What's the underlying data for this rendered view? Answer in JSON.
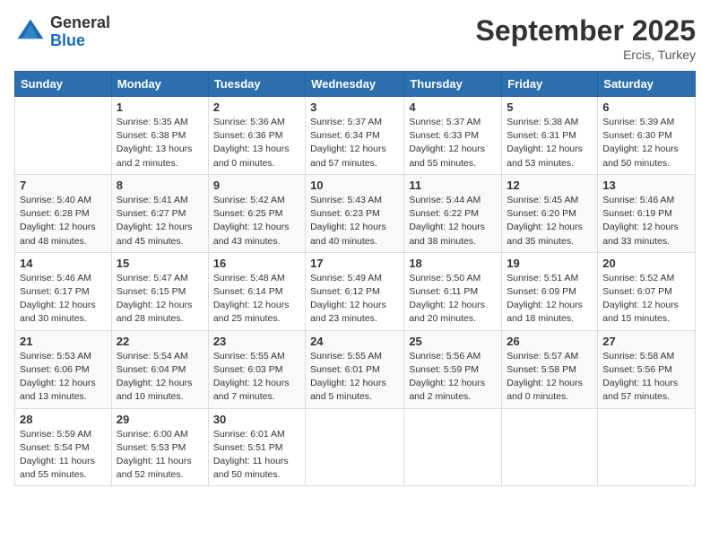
{
  "header": {
    "logo_general": "General",
    "logo_blue": "Blue",
    "month_title": "September 2025",
    "location": "Ercis, Turkey"
  },
  "days_of_week": [
    "Sunday",
    "Monday",
    "Tuesday",
    "Wednesday",
    "Thursday",
    "Friday",
    "Saturday"
  ],
  "weeks": [
    [
      {
        "day": null
      },
      {
        "day": 1,
        "sunrise": "Sunrise: 5:35 AM",
        "sunset": "Sunset: 6:38 PM",
        "daylight": "Daylight: 13 hours and 2 minutes."
      },
      {
        "day": 2,
        "sunrise": "Sunrise: 5:36 AM",
        "sunset": "Sunset: 6:36 PM",
        "daylight": "Daylight: 13 hours and 0 minutes."
      },
      {
        "day": 3,
        "sunrise": "Sunrise: 5:37 AM",
        "sunset": "Sunset: 6:34 PM",
        "daylight": "Daylight: 12 hours and 57 minutes."
      },
      {
        "day": 4,
        "sunrise": "Sunrise: 5:37 AM",
        "sunset": "Sunset: 6:33 PM",
        "daylight": "Daylight: 12 hours and 55 minutes."
      },
      {
        "day": 5,
        "sunrise": "Sunrise: 5:38 AM",
        "sunset": "Sunset: 6:31 PM",
        "daylight": "Daylight: 12 hours and 53 minutes."
      },
      {
        "day": 6,
        "sunrise": "Sunrise: 5:39 AM",
        "sunset": "Sunset: 6:30 PM",
        "daylight": "Daylight: 12 hours and 50 minutes."
      }
    ],
    [
      {
        "day": 7,
        "sunrise": "Sunrise: 5:40 AM",
        "sunset": "Sunset: 6:28 PM",
        "daylight": "Daylight: 12 hours and 48 minutes."
      },
      {
        "day": 8,
        "sunrise": "Sunrise: 5:41 AM",
        "sunset": "Sunset: 6:27 PM",
        "daylight": "Daylight: 12 hours and 45 minutes."
      },
      {
        "day": 9,
        "sunrise": "Sunrise: 5:42 AM",
        "sunset": "Sunset: 6:25 PM",
        "daylight": "Daylight: 12 hours and 43 minutes."
      },
      {
        "day": 10,
        "sunrise": "Sunrise: 5:43 AM",
        "sunset": "Sunset: 6:23 PM",
        "daylight": "Daylight: 12 hours and 40 minutes."
      },
      {
        "day": 11,
        "sunrise": "Sunrise: 5:44 AM",
        "sunset": "Sunset: 6:22 PM",
        "daylight": "Daylight: 12 hours and 38 minutes."
      },
      {
        "day": 12,
        "sunrise": "Sunrise: 5:45 AM",
        "sunset": "Sunset: 6:20 PM",
        "daylight": "Daylight: 12 hours and 35 minutes."
      },
      {
        "day": 13,
        "sunrise": "Sunrise: 5:46 AM",
        "sunset": "Sunset: 6:19 PM",
        "daylight": "Daylight: 12 hours and 33 minutes."
      }
    ],
    [
      {
        "day": 14,
        "sunrise": "Sunrise: 5:46 AM",
        "sunset": "Sunset: 6:17 PM",
        "daylight": "Daylight: 12 hours and 30 minutes."
      },
      {
        "day": 15,
        "sunrise": "Sunrise: 5:47 AM",
        "sunset": "Sunset: 6:15 PM",
        "daylight": "Daylight: 12 hours and 28 minutes."
      },
      {
        "day": 16,
        "sunrise": "Sunrise: 5:48 AM",
        "sunset": "Sunset: 6:14 PM",
        "daylight": "Daylight: 12 hours and 25 minutes."
      },
      {
        "day": 17,
        "sunrise": "Sunrise: 5:49 AM",
        "sunset": "Sunset: 6:12 PM",
        "daylight": "Daylight: 12 hours and 23 minutes."
      },
      {
        "day": 18,
        "sunrise": "Sunrise: 5:50 AM",
        "sunset": "Sunset: 6:11 PM",
        "daylight": "Daylight: 12 hours and 20 minutes."
      },
      {
        "day": 19,
        "sunrise": "Sunrise: 5:51 AM",
        "sunset": "Sunset: 6:09 PM",
        "daylight": "Daylight: 12 hours and 18 minutes."
      },
      {
        "day": 20,
        "sunrise": "Sunrise: 5:52 AM",
        "sunset": "Sunset: 6:07 PM",
        "daylight": "Daylight: 12 hours and 15 minutes."
      }
    ],
    [
      {
        "day": 21,
        "sunrise": "Sunrise: 5:53 AM",
        "sunset": "Sunset: 6:06 PM",
        "daylight": "Daylight: 12 hours and 13 minutes."
      },
      {
        "day": 22,
        "sunrise": "Sunrise: 5:54 AM",
        "sunset": "Sunset: 6:04 PM",
        "daylight": "Daylight: 12 hours and 10 minutes."
      },
      {
        "day": 23,
        "sunrise": "Sunrise: 5:55 AM",
        "sunset": "Sunset: 6:03 PM",
        "daylight": "Daylight: 12 hours and 7 minutes."
      },
      {
        "day": 24,
        "sunrise": "Sunrise: 5:55 AM",
        "sunset": "Sunset: 6:01 PM",
        "daylight": "Daylight: 12 hours and 5 minutes."
      },
      {
        "day": 25,
        "sunrise": "Sunrise: 5:56 AM",
        "sunset": "Sunset: 5:59 PM",
        "daylight": "Daylight: 12 hours and 2 minutes."
      },
      {
        "day": 26,
        "sunrise": "Sunrise: 5:57 AM",
        "sunset": "Sunset: 5:58 PM",
        "daylight": "Daylight: 12 hours and 0 minutes."
      },
      {
        "day": 27,
        "sunrise": "Sunrise: 5:58 AM",
        "sunset": "Sunset: 5:56 PM",
        "daylight": "Daylight: 11 hours and 57 minutes."
      }
    ],
    [
      {
        "day": 28,
        "sunrise": "Sunrise: 5:59 AM",
        "sunset": "Sunset: 5:54 PM",
        "daylight": "Daylight: 11 hours and 55 minutes."
      },
      {
        "day": 29,
        "sunrise": "Sunrise: 6:00 AM",
        "sunset": "Sunset: 5:53 PM",
        "daylight": "Daylight: 11 hours and 52 minutes."
      },
      {
        "day": 30,
        "sunrise": "Sunrise: 6:01 AM",
        "sunset": "Sunset: 5:51 PM",
        "daylight": "Daylight: 11 hours and 50 minutes."
      },
      {
        "day": null
      },
      {
        "day": null
      },
      {
        "day": null
      },
      {
        "day": null
      }
    ]
  ]
}
